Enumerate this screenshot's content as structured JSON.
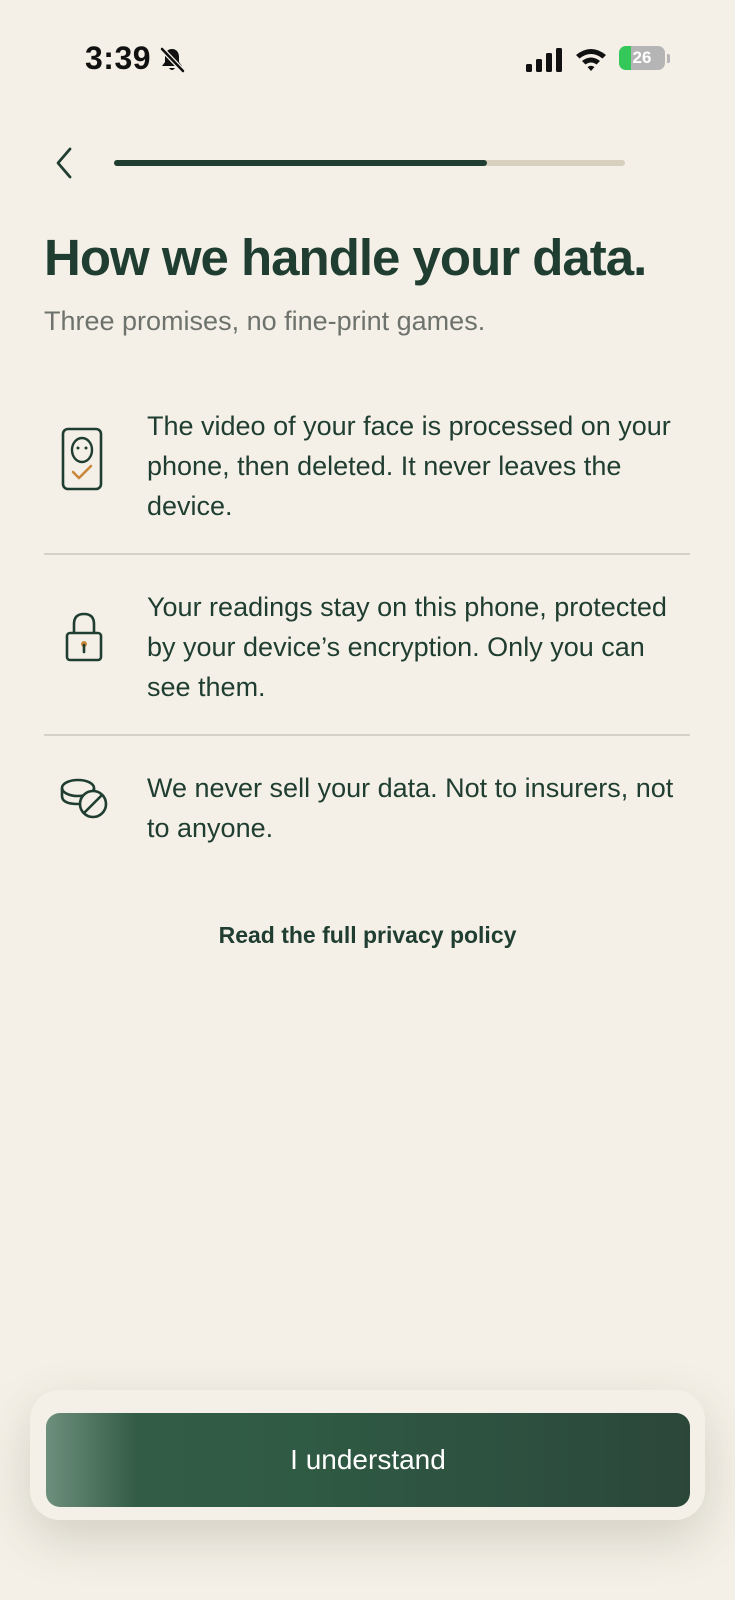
{
  "status_bar": {
    "time": "3:39",
    "battery_percent": "26",
    "battery_level": 0.26,
    "icons": [
      "bell-slash-icon",
      "cellular-signal-icon",
      "wifi-icon",
      "battery-charging-icon"
    ]
  },
  "nav": {
    "back_icon": "chevron-left-icon",
    "progress": 0.73
  },
  "header": {
    "title": "How we handle your data.",
    "subtitle": "Three promises, no fine-print games."
  },
  "promises": [
    {
      "icon": "phone-face-check-icon",
      "text": "The video of your face is processed on your phone, then deleted. It never leaves the device."
    },
    {
      "icon": "lock-icon",
      "text": "Your readings stay on this phone, protected by your device’s encryption. Only you can see them."
    },
    {
      "icon": "no-sale-coins-icon",
      "text": "We never sell your data. Not to insurers, not to anyone."
    }
  ],
  "privacy_link": "Read the full privacy policy",
  "cta_label": "I understand",
  "colors": {
    "background": "#f4f0e7",
    "primary": "#1f3d30",
    "accent_check": "#c9873b",
    "subtitle": "#6d736c",
    "divider": "#d6d1c6"
  }
}
